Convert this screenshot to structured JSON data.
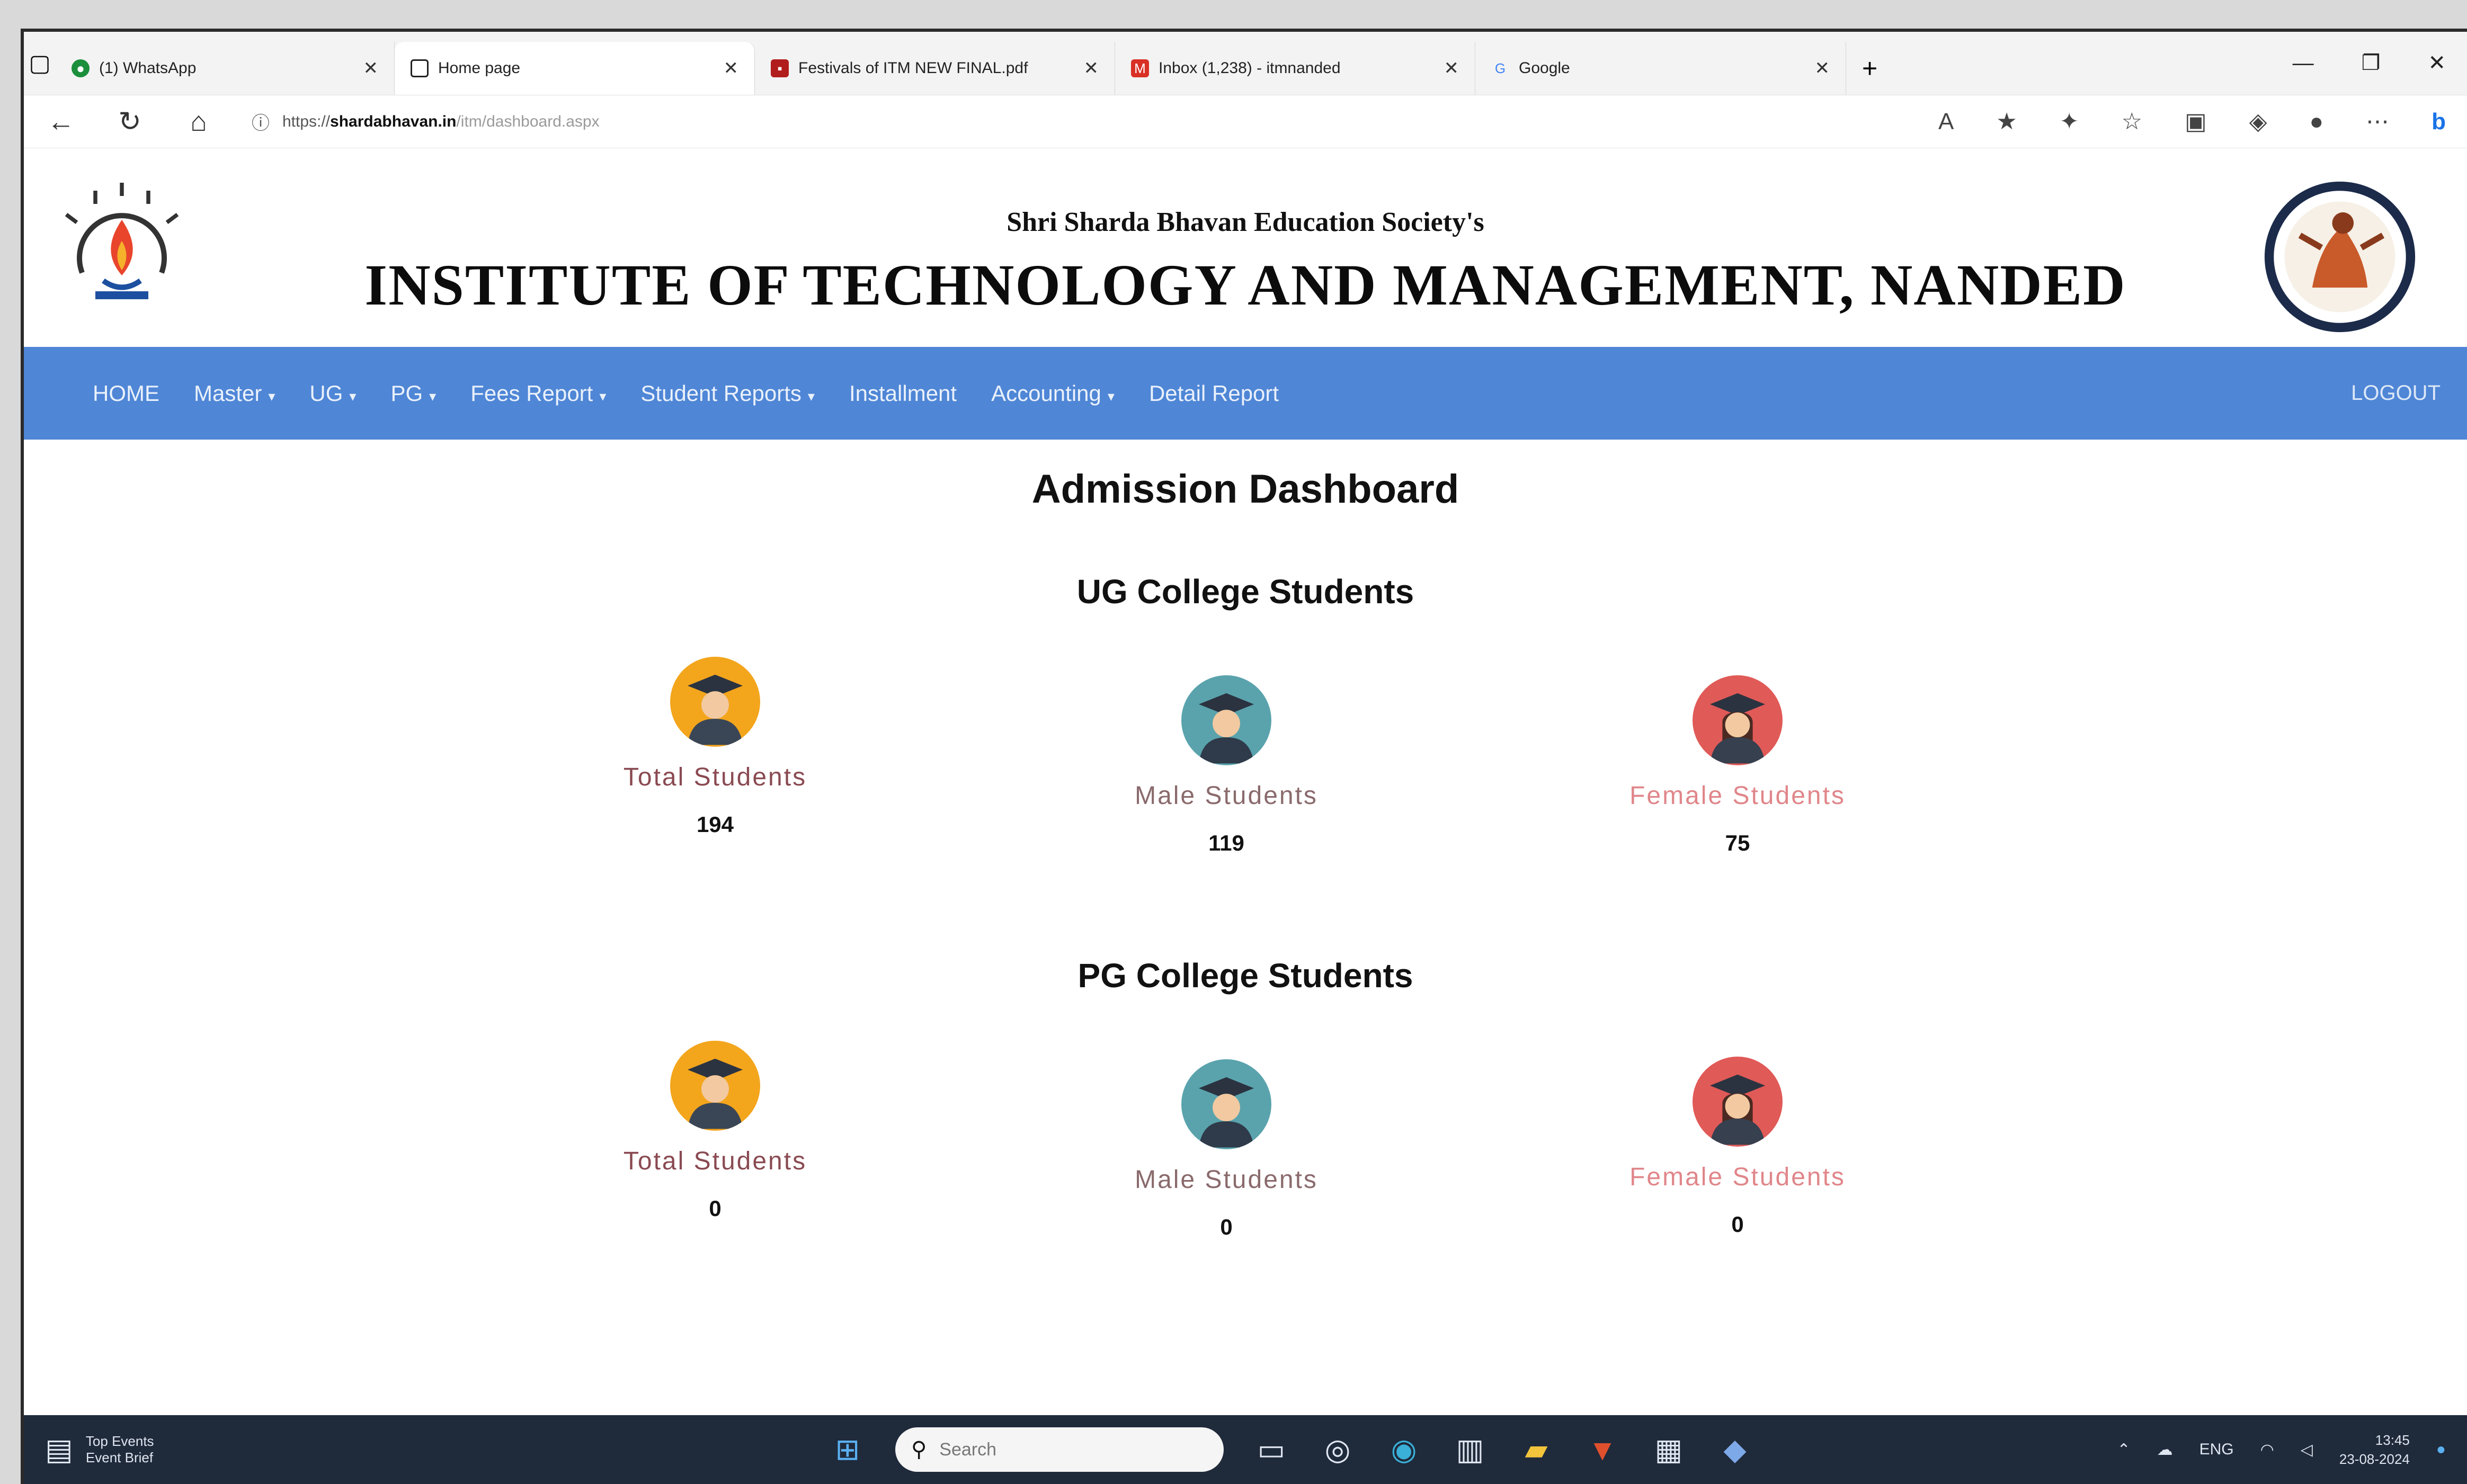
{
  "browser": {
    "tabs": [
      {
        "title": "(1) WhatsApp",
        "active": false
      },
      {
        "title": "Home page",
        "active": true
      },
      {
        "title": "Festivals of ITM NEW FINAL.pdf",
        "active": false
      },
      {
        "title": "Inbox (1,238) - itmnanded",
        "active": false
      },
      {
        "title": "Google",
        "active": false
      }
    ],
    "url_host": "shardabhavan.in",
    "url_prefix": "https://",
    "url_path": "/itm/dashboard.aspx"
  },
  "site": {
    "society": "Shri Sharda Bhavan Education Society's",
    "institute": "INSTITUTE OF TECHNOLOGY AND MANAGEMENT, NANDED"
  },
  "nav": {
    "items": [
      {
        "label": "HOME",
        "caret": false
      },
      {
        "label": "Master",
        "caret": true
      },
      {
        "label": "UG",
        "caret": true
      },
      {
        "label": "PG",
        "caret": true
      },
      {
        "label": "Fees Report",
        "caret": true
      },
      {
        "label": "Student Reports",
        "caret": true
      },
      {
        "label": "Installment",
        "caret": false
      },
      {
        "label": "Accounting",
        "caret": true
      },
      {
        "label": "Detail Report",
        "caret": false
      }
    ],
    "logout": "LOGOUT"
  },
  "dashboard": {
    "title": "Admission Dashboard",
    "ug": {
      "title": "UG College Students",
      "total_label": "Total Students",
      "total": "194",
      "male_label": "Male Students",
      "male": "119",
      "female_label": "Female Students",
      "female": "75"
    },
    "pg": {
      "title": "PG College Students",
      "total_label": "Total Students",
      "total": "0",
      "male_label": "Male Students",
      "male": "0",
      "female_label": "Female Students",
      "female": "0"
    }
  },
  "taskbar": {
    "weather_title": "Top Events",
    "weather_sub": "Event Brief",
    "search_placeholder": "Search",
    "lang": "ENG",
    "time": "13:45",
    "date": "23-08-2024"
  },
  "colors": {
    "navbar": "#4f86d6",
    "total_avatar": "#f3a51c",
    "male_avatar": "#5aa3ad",
    "female_avatar": "#e05a57"
  }
}
